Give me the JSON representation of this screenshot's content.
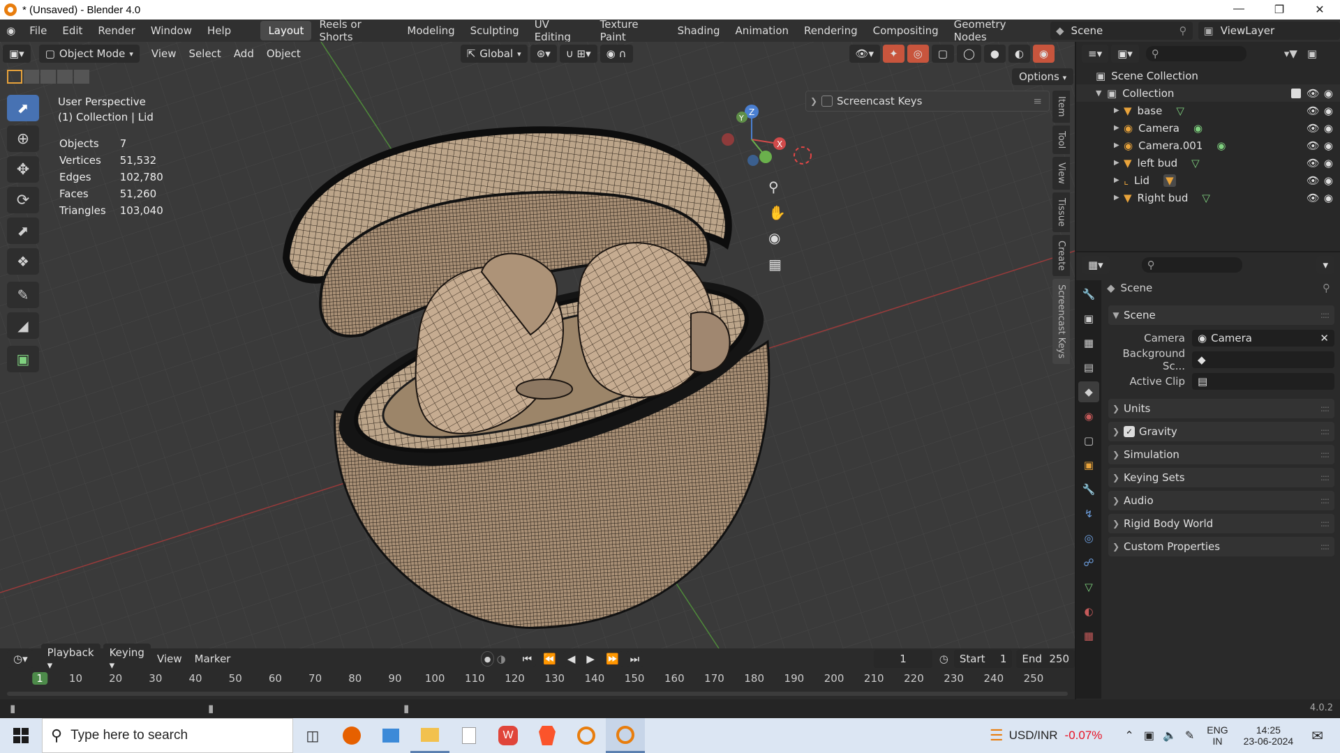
{
  "window": {
    "title": "* (Unsaved) - Blender 4.0"
  },
  "menu": [
    "File",
    "Edit",
    "Render",
    "Window",
    "Help"
  ],
  "workspaces": [
    "Layout",
    "Reels or Shorts",
    "Modeling",
    "Sculpting",
    "UV Editing",
    "Texture Paint",
    "Shading",
    "Animation",
    "Rendering",
    "Compositing",
    "Geometry Nodes"
  ],
  "active_workspace": "Layout",
  "scene_name": "Scene",
  "view_layer": "ViewLayer",
  "viewport": {
    "mode": "Object Mode",
    "header_menus": [
      "View",
      "Select",
      "Add",
      "Object"
    ],
    "orientation": "Global",
    "options_label": "Options",
    "perspective": "User Perspective",
    "context": "(1) Collection | Lid",
    "stats": [
      {
        "label": "Objects",
        "value": "7"
      },
      {
        "label": "Vertices",
        "value": "51,532"
      },
      {
        "label": "Edges",
        "value": "102,780"
      },
      {
        "label": "Faces",
        "value": "51,260"
      },
      {
        "label": "Triangles",
        "value": "103,040"
      }
    ],
    "screencast_label": "Screencast Keys",
    "side_tabs": [
      "Item",
      "Tool",
      "View",
      "Tissue",
      "Create",
      "Screencast Keys"
    ],
    "gizmo_axes": {
      "x": "X",
      "y": "Y",
      "z": "Z"
    }
  },
  "timeline": {
    "menus": [
      "Playback",
      "Keying",
      "View",
      "Marker"
    ],
    "current_frame": "1",
    "start_label": "Start",
    "start": "1",
    "end_label": "End",
    "end": "250",
    "ticks": [
      "1",
      "10",
      "20",
      "30",
      "40",
      "50",
      "60",
      "70",
      "80",
      "90",
      "100",
      "110",
      "120",
      "130",
      "140",
      "150",
      "160",
      "170",
      "180",
      "190",
      "200",
      "210",
      "220",
      "230",
      "240",
      "250"
    ]
  },
  "version": "4.0.2",
  "outliner": {
    "root": "Scene Collection",
    "collection": "Collection",
    "items": [
      "base",
      "Camera",
      "Camera.001",
      "left bud",
      "Lid",
      "Right bud"
    ]
  },
  "properties": {
    "context": "Scene",
    "section": "Scene",
    "fields": [
      {
        "label": "Camera",
        "value": "Camera"
      },
      {
        "label": "Background Sc...",
        "value": ""
      },
      {
        "label": "Active Clip",
        "value": ""
      }
    ],
    "panels": [
      "Units",
      "Gravity",
      "Simulation",
      "Keying Sets",
      "Audio",
      "Rigid Body World",
      "Custom Properties"
    ]
  },
  "taskbar": {
    "search_placeholder": "Type here to search",
    "ticker": "USD/INR",
    "ticker_change": "-0.07%",
    "lang": "ENG",
    "region": "IN",
    "time": "14:25",
    "date": "23-06-2024"
  },
  "colors": {
    "accent": "#4772b3",
    "ticker_negative": "#e81123",
    "workspace_active": "#4a4a4a"
  }
}
